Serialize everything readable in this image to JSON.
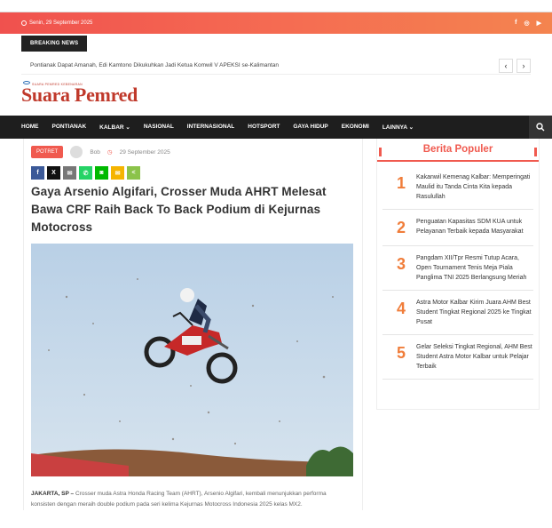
{
  "topbar": {
    "date": "Senin, 29 September 2025",
    "social": [
      "f",
      "◎",
      "▶"
    ]
  },
  "breaking": {
    "label": "BREAKING NEWS",
    "headline": "Pontianak Dapat Amanah, Edi Kamtono Dikukuhkan Jadi Ketua Komwil V APEKSI se-Kalimantan"
  },
  "logo": {
    "text": "Suara Pemred",
    "tagline": "SUARA PEMRED KEBENARAN"
  },
  "nav": {
    "items": [
      "HOME",
      "PONTIANAK",
      "KALBAR ⌄",
      "NASIONAL",
      "INTERNASIONAL",
      "HOTSPORT",
      "GAYA HIDUP",
      "EKONOMI",
      "LAINNYA ⌄"
    ]
  },
  "article": {
    "category": "POTRET",
    "author": "Bob",
    "date": "29 September 2025",
    "title": "Gaya Arsenio Algifari, Crosser Muda AHRT Melesat Bawa CRF Raih Back To Back Podium di Kejurnas Motocross",
    "caption_lead": "JAKARTA, SP –",
    "caption_body": " Crosser muda Astra Honda Racing Team (AHRT), Arsenio Algifari, kembali menunjukkan performa konsisten dengan meraih double podium pada seri kelima Kejurnas Motocross Indonesia 2025 kelas MX2."
  },
  "share_buttons": [
    {
      "icon": "facebook-icon",
      "glyph": "f",
      "color": "#3b5998"
    },
    {
      "icon": "x-icon",
      "glyph": "X",
      "color": "#111111"
    },
    {
      "icon": "email-icon",
      "glyph": "✉",
      "color": "#777777"
    },
    {
      "icon": "whatsapp-icon",
      "glyph": "✆",
      "color": "#25d366"
    },
    {
      "icon": "line-icon",
      "glyph": "◙",
      "color": "#00b900"
    },
    {
      "icon": "sms-icon",
      "glyph": "✉",
      "color": "#f5b400"
    },
    {
      "icon": "share-icon",
      "glyph": "<",
      "color": "#8bc34a"
    }
  ],
  "sidebar": {
    "title": "Berita Populer",
    "items": [
      {
        "num": "1",
        "text": "Kakanwil Kemenag Kalbar: Memperingati Maulid itu Tanda Cinta Kita kepada Rasulullah"
      },
      {
        "num": "2",
        "text": "Penguatan Kapasitas SDM KUA untuk Pelayanan Terbaik kepada Masyarakat"
      },
      {
        "num": "3",
        "text": "Pangdam XII/Tpr Resmi Tutup Acara, Open Tournament Tenis Meja Piala Panglima TNI 2025 Berlangsung Meriah"
      },
      {
        "num": "4",
        "text": "Astra Motor Kalbar Kirim Juara AHM Best Student Tingkat Regional 2025 ke Tingkat Pusat"
      },
      {
        "num": "5",
        "text": "Gelar Seleksi Tingkat Regional, AHM Best Student Astra Motor Kalbar untuk Pelajar Terbaik"
      }
    ]
  }
}
